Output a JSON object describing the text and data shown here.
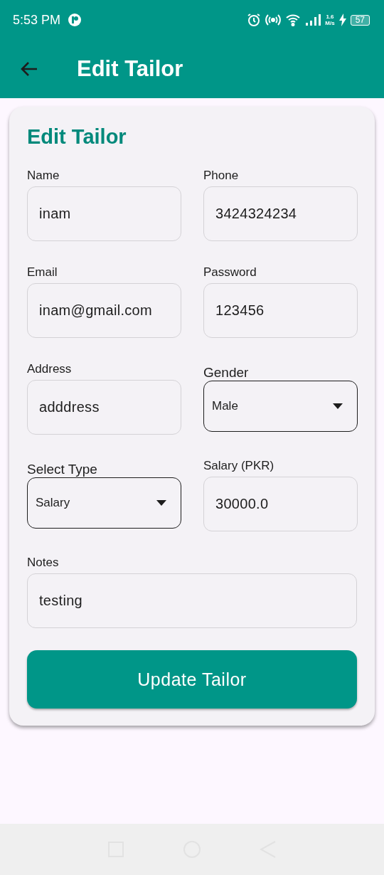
{
  "status_bar": {
    "time": "5:53 PM",
    "speed_value": "1.6",
    "speed_unit": "M/s",
    "battery": "57"
  },
  "app_bar": {
    "title": "Edit Tailor"
  },
  "form": {
    "title": "Edit Tailor",
    "rows": [
      [
        {
          "kind": "text",
          "label": "Name",
          "value": "inam"
        },
        {
          "kind": "text",
          "label": "Phone",
          "value": "3424324234"
        }
      ],
      [
        {
          "kind": "text",
          "label": "Email",
          "value": "inam@gmail.com"
        },
        {
          "kind": "text",
          "label": "Password",
          "value": "123456"
        }
      ],
      [
        {
          "kind": "text",
          "label": "Address",
          "value": "adddress"
        },
        {
          "kind": "dropdown",
          "label": "Gender",
          "value": "Male"
        }
      ],
      [
        {
          "kind": "dropdown",
          "label": "Select Type",
          "value": "Salary"
        },
        {
          "kind": "text",
          "label": "Salary (PKR)",
          "value": "30000.0"
        }
      ],
      [
        {
          "kind": "text",
          "label": "Notes",
          "value": "testing"
        }
      ]
    ],
    "submit": "Update Tailor"
  }
}
